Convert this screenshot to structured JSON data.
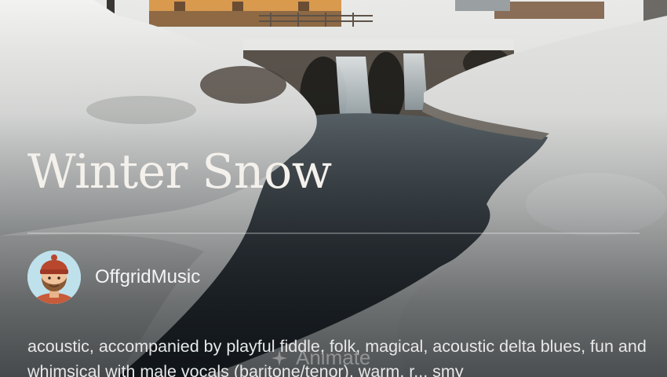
{
  "song": {
    "title": "Winter Snow"
  },
  "creator": {
    "name": "OffgridMusic"
  },
  "actions": {
    "animate_label": "Animate"
  },
  "style_tags": "acoustic, accompanied by playful fiddle, folk, magical, acoustic delta blues, fun and whimsical with male vocals (baritone/tenor), warm, r... smy",
  "colors": {
    "title": "#f4f1ec",
    "text": "#e8e8e8",
    "divider": "rgba(255,255,255,0.28)",
    "background": "#1d2226"
  },
  "icons": {
    "avatar": "bearded-man-avatar",
    "animate": "sparkle-icon"
  }
}
